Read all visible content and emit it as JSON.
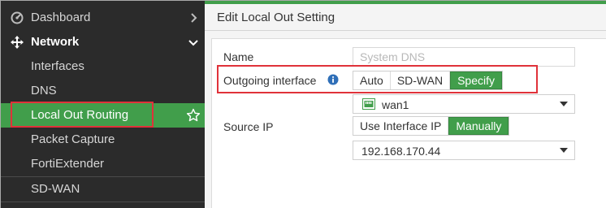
{
  "sidebar": {
    "items": [
      {
        "label": "Dashboard",
        "icon": "dashboard-icon",
        "trail": "chevron-right-icon"
      },
      {
        "label": "Network",
        "icon": "move-arrows-icon",
        "trail": "chevron-down-icon"
      },
      {
        "label": "Interfaces"
      },
      {
        "label": "DNS"
      },
      {
        "label": "Local Out Routing",
        "trail": "star-outline-icon"
      },
      {
        "label": "Packet Capture"
      },
      {
        "label": "FortiExtender"
      },
      {
        "label": "SD-WAN"
      }
    ]
  },
  "page": {
    "title": "Edit Local Out Setting"
  },
  "form": {
    "name_label": "Name",
    "name_placeholder": "System DNS",
    "outgoing_label": "Outgoing interface",
    "outgoing_options": [
      "Auto",
      "SD-WAN",
      "Specify"
    ],
    "outgoing_selected": "Specify",
    "interface_value": "wan1",
    "source_ip_label": "Source IP",
    "source_ip_options": [
      "Use Interface IP",
      "Manually"
    ],
    "source_ip_selected": "Manually",
    "source_ip_value": "192.168.170.44"
  },
  "colors": {
    "accent": "#419e4b",
    "sidebar_bg": "#2b2b2b",
    "highlight": "#e0323a"
  }
}
